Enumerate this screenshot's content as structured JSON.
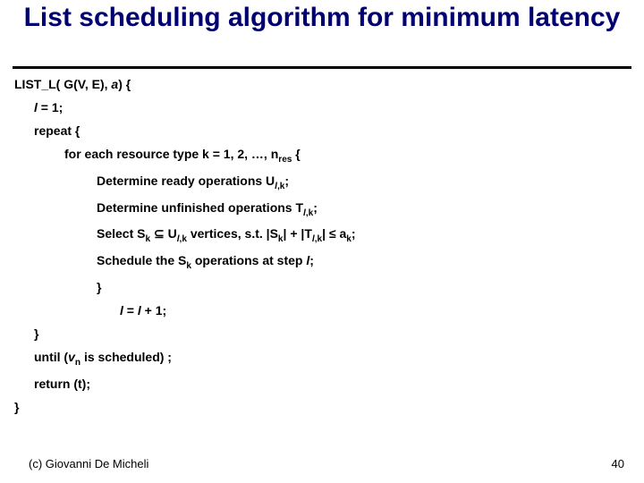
{
  "title": "List scheduling algorithm for minimum latency",
  "code": {
    "l0_pre": "LIST_L( G(V, E), ",
    "l0_a": "a",
    "l0_post": ") {",
    "l1_pre": "",
    "l1_l": "l",
    "l1_post": " = 1;",
    "l2": "repeat {",
    "l3_pre": "for each resource type k = 1, 2, …, n",
    "l3_sub": "res",
    "l3_post": " {",
    "l4_pre": "Determine ready operations U",
    "l4_sub_pre": "l",
    "l4_sub_post": ",k",
    "l4_post": ";",
    "l5_pre": "Determine unfinished operations T",
    "l5_sub_pre": "l",
    "l5_sub_post": ",k",
    "l5_post": ";",
    "l6_pre": "Select S",
    "l6_sub1": "k",
    "l6_mid1": " ⊆ U",
    "l6_sub2_pre": "l",
    "l6_sub2_post": ",k",
    "l6_mid2": " vertices, s.t. |S",
    "l6_sub3": "k",
    "l6_mid3": "| + |T",
    "l6_sub4_pre": "l",
    "l6_sub4_post": ",k",
    "l6_mid4": "| ≤ a",
    "l6_sub5": "k",
    "l6_post": ";",
    "l7_pre": "Schedule the S",
    "l7_sub": "k",
    "l7_mid": " operations at step ",
    "l7_l": "l",
    "l7_post": ";",
    "l8": "}",
    "l9_l1": "l",
    "l9_mid": " = ",
    "l9_l2": "l",
    "l9_post": " + 1;",
    "l10": "}",
    "l11_pre": "until (",
    "l11_v": "v",
    "l11_sub": "n",
    "l11_post": " is scheduled) ;",
    "l12": "return (t);",
    "l13": "}"
  },
  "footer": {
    "left": "(c)  Giovanni De Micheli",
    "right": "40"
  }
}
